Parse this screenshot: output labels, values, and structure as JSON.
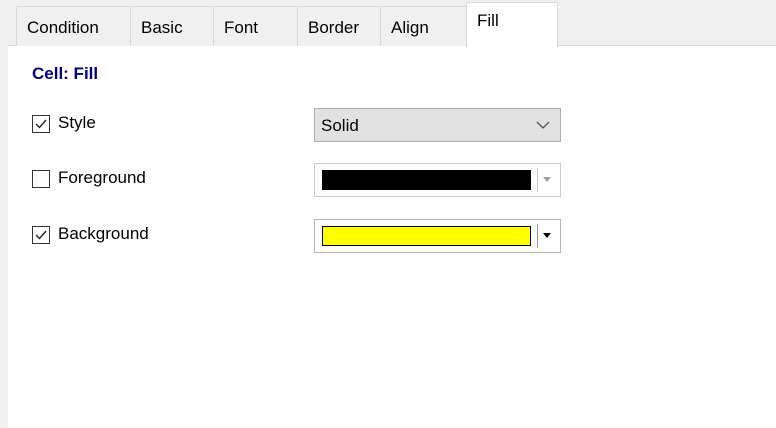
{
  "tabs": [
    {
      "label": "Condition"
    },
    {
      "label": "Basic"
    },
    {
      "label": "Font"
    },
    {
      "label": "Border"
    },
    {
      "label": "Align"
    },
    {
      "label": "Fill",
      "active": true
    }
  ],
  "section_title": "Cell: Fill",
  "style_row": {
    "label": "Style",
    "checked": true,
    "value": "Solid",
    "icon": "chevron-down-icon"
  },
  "foreground_row": {
    "label": "Foreground",
    "checked": false,
    "color": "#000000",
    "enabled": false,
    "icon": "dropdown-arrow-icon"
  },
  "background_row": {
    "label": "Background",
    "checked": true,
    "color": "#ffff00",
    "enabled": true,
    "icon": "dropdown-arrow-icon"
  }
}
